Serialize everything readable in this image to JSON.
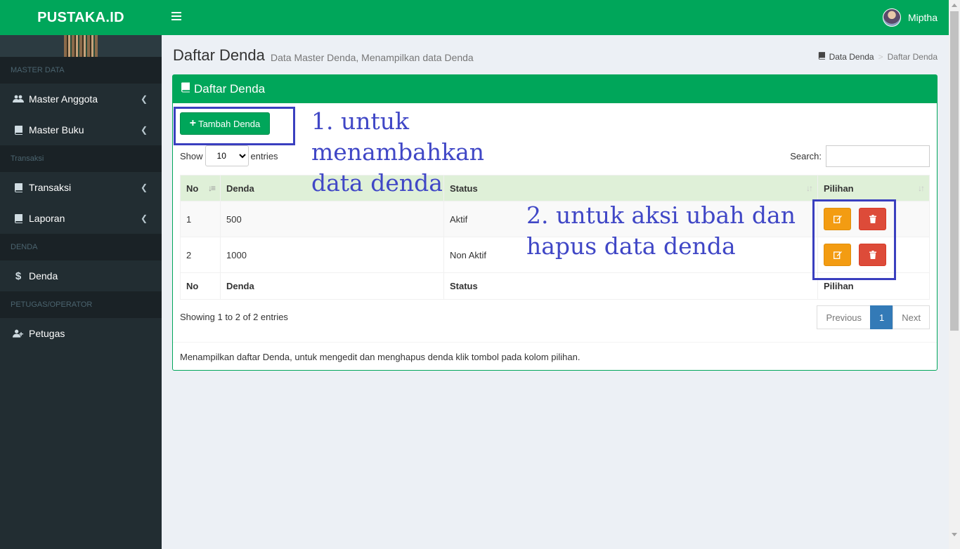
{
  "app": {
    "logo": "PUSTAKA.ID",
    "user": "Miptha"
  },
  "sidebar": {
    "groups": [
      {
        "header": "MASTER DATA"
      },
      {
        "header": "Transaksi"
      },
      {
        "header": "DENDA"
      },
      {
        "header": "PETUGAS/OPERATOR"
      }
    ],
    "items": [
      {
        "label": "Master Anggota",
        "icon": "users-icon"
      },
      {
        "label": "Master Buku",
        "icon": "book-icon"
      },
      {
        "label": "Transaksi",
        "icon": "book-icon"
      },
      {
        "label": "Laporan",
        "icon": "book-icon"
      },
      {
        "label": "Denda",
        "icon": "dollar-icon"
      },
      {
        "label": "Petugas",
        "icon": "user-plus-icon"
      }
    ]
  },
  "page": {
    "title": "Daftar Denda",
    "subtitle": "Data Master Denda, Menampilkan data Denda",
    "breadcrumb": [
      "Data Denda",
      "Daftar Denda"
    ]
  },
  "box": {
    "title": "Daftar Denda",
    "add_button": "Tambah Denda",
    "show_label": "Show",
    "entries_value": "10",
    "entries_label": "entries",
    "search_label": "Search:",
    "columns": [
      "No",
      "Denda",
      "Status",
      "Pilihan"
    ],
    "rows": [
      {
        "no": "1",
        "denda": "500",
        "status": "Aktif"
      },
      {
        "no": "2",
        "denda": "1000",
        "status": "Non Aktif"
      }
    ],
    "info": "Showing 1 to 2 of 2 entries",
    "pager": {
      "prev": "Previous",
      "current": "1",
      "next": "Next"
    },
    "footer_note": "Menampilkan daftar Denda, untuk mengedit dan menghapus denda klik tombol pada kolom pilihan."
  },
  "annotations": {
    "note1": [
      "1. untuk",
      "menambahkan",
      "data denda"
    ],
    "note2": [
      "2. untuk aksi ubah dan",
      "hapus data denda"
    ],
    "color": "#3a3fbf"
  },
  "colors": {
    "primary": "#00a65a",
    "sidebar": "#222d32",
    "warning": "#f39c12",
    "danger": "#dd4b39",
    "page_active": "#337ab7"
  }
}
